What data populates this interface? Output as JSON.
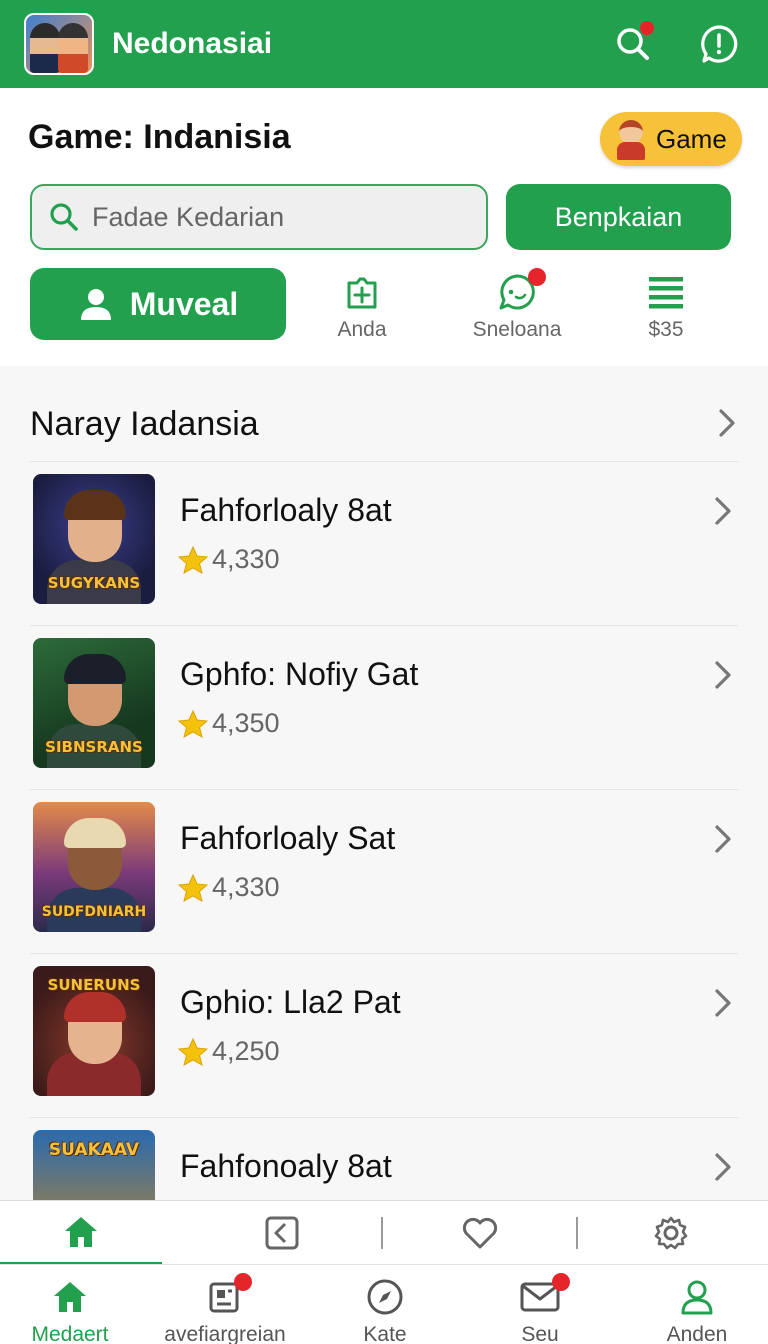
{
  "colors": {
    "brand": "#23a04e",
    "badge": "#f7c23a",
    "notification": "#e5252a",
    "star": "#f4c20d"
  },
  "topbar": {
    "title": "Nedonasiai",
    "icons": [
      "search-icon",
      "info-icon"
    ]
  },
  "header": {
    "title": "Game: Indanisia",
    "badge_label": "Game",
    "search_placeholder": "Fadae Kedarian",
    "search_button": "Benpkaian",
    "primary_tab": "Muveal",
    "quick_actions": [
      {
        "label": "Anda",
        "icon": "add-icon"
      },
      {
        "label": "Sneloana",
        "icon": "chat-icon"
      },
      {
        "label": "$35",
        "icon": "menu-icon"
      }
    ]
  },
  "section": {
    "title": "Naray Iadansia"
  },
  "games": [
    {
      "name": "Fahforloaly 8at",
      "rating": "4,330",
      "thumb_text": "SUGYKANS"
    },
    {
      "name": "Gphfo: Nofiy Gat",
      "rating": "4,350",
      "thumb_text": "SIBNSRANS"
    },
    {
      "name": "Fahforloaly Sat",
      "rating": "4,330",
      "thumb_text": "SUDFDNIARH"
    },
    {
      "name": "Gphio: Lla2 Pat",
      "rating": "4,250",
      "thumb_text": "SUNERUNS"
    },
    {
      "name": "Fahfonoaly 8at",
      "rating": "",
      "thumb_text": "SUAKAAV"
    }
  ],
  "toolbar": {
    "icons": [
      "home-icon",
      "back-icon",
      "heart-icon",
      "gear-icon"
    ]
  },
  "bottom_nav": [
    {
      "label": "Medaert",
      "icon": "home-icon",
      "active": true
    },
    {
      "label": "avefiargreian",
      "icon": "news-icon"
    },
    {
      "label": "Kate",
      "icon": "compass-icon"
    },
    {
      "label": "Seu",
      "icon": "mail-icon"
    },
    {
      "label": "Anden",
      "icon": "user-icon"
    }
  ]
}
